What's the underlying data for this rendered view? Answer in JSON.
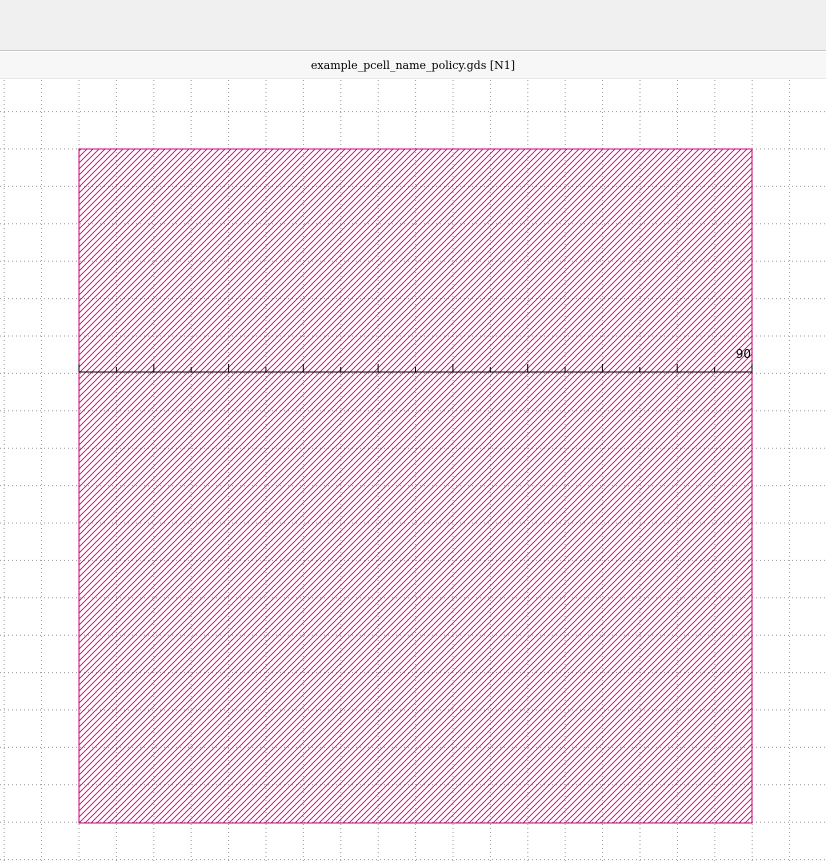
{
  "window": {
    "title": "example_pcell_name_policy.gds [N1]"
  },
  "layout": {
    "shape_color": "#cc0077",
    "grid_color": "#9a9a9a",
    "ruler_color": "#000000",
    "ruler_label": "90",
    "ruler_tick_count": 18
  }
}
